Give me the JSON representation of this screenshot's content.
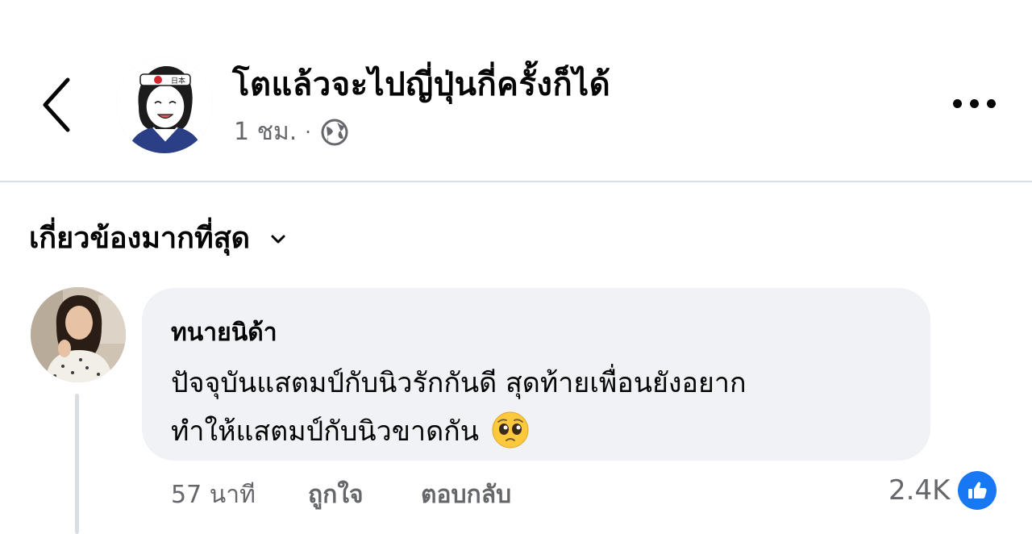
{
  "header": {
    "page_name": "โตแล้วจะไปญี่ปุ่นกี่ครั้งก็ได้",
    "time": "1 ชม.",
    "separator": "·",
    "audience_icon": "globe-icon",
    "more_icon": "more-horizontal-icon",
    "back_icon": "back-chevron-icon"
  },
  "sort": {
    "label": "เกี่ยวข้องมากที่สุด",
    "icon": "chevron-down-icon"
  },
  "comment": {
    "author": "ทนายนิด้า",
    "lines": [
      "ปัจจุบันแสตมป์กับนิวรักกันดี สุดท้ายเพื่อนยังอยาก",
      "ทำให้แสตมป์กับนิวขาดกัน"
    ],
    "emoji": "pleading-face-emoji",
    "timestamp": "57 นาที",
    "like_label": "ถูกใจ",
    "reply_label": "ตอบกลับ",
    "reaction_count": "2.4K",
    "reaction_icon": "like-icon"
  },
  "colors": {
    "bubble_bg": "#f0f2f5",
    "secondary_text": "#65676b",
    "primary_text": "#050505",
    "like_blue": "#1877f2",
    "divider": "#dadde1"
  }
}
